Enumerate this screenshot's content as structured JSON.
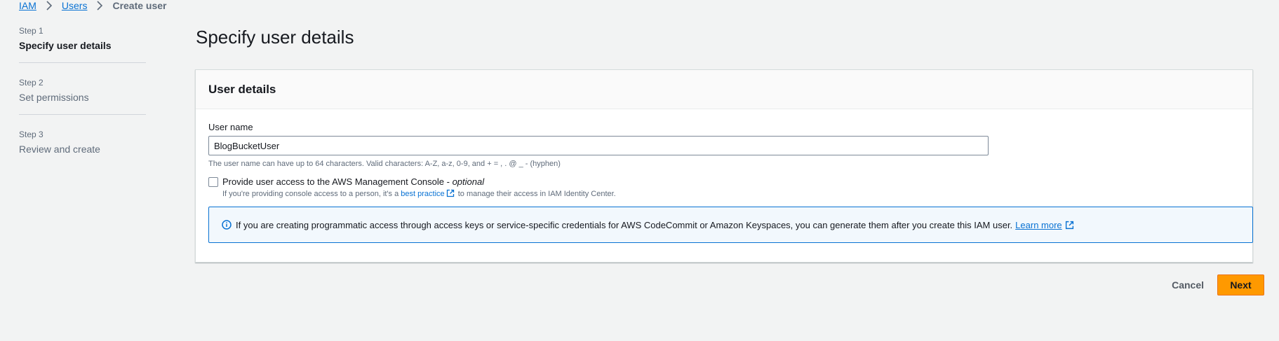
{
  "breadcrumb": {
    "items": [
      "IAM",
      "Users"
    ],
    "current": "Create user"
  },
  "steps": [
    {
      "num": "Step 1",
      "title": "Specify user details",
      "active": true
    },
    {
      "num": "Step 2",
      "title": "Set permissions",
      "active": false
    },
    {
      "num": "Step 3",
      "title": "Review and create",
      "active": false
    }
  ],
  "page": {
    "title": "Specify user details"
  },
  "user_details": {
    "header": "User details",
    "username_label": "User name",
    "username_value": "BlogBucketUser",
    "username_constraint": "The user name can have up to 64 characters. Valid characters: A-Z, a-z, 0-9, and + = , . @ _ - (hyphen)",
    "console_access_label": "Provide user access to the AWS Management Console -",
    "console_access_optional": "optional",
    "console_access_checked": false,
    "console_desc_before": "If you're providing console access to a person, it's a",
    "console_desc_link": "best practice",
    "console_desc_after": "to manage their access in IAM Identity Center."
  },
  "info_alert": {
    "text": "If you are creating programmatic access through access keys or service-specific credentials for AWS CodeCommit or Amazon Keyspaces, you can generate them after you create this IAM user.",
    "link": "Learn more"
  },
  "actions": {
    "cancel_label": "Cancel",
    "next_label": "Next"
  },
  "colors": {
    "link": "#0972d3",
    "primary_button": "#ff9900",
    "background": "#f2f3f3"
  }
}
